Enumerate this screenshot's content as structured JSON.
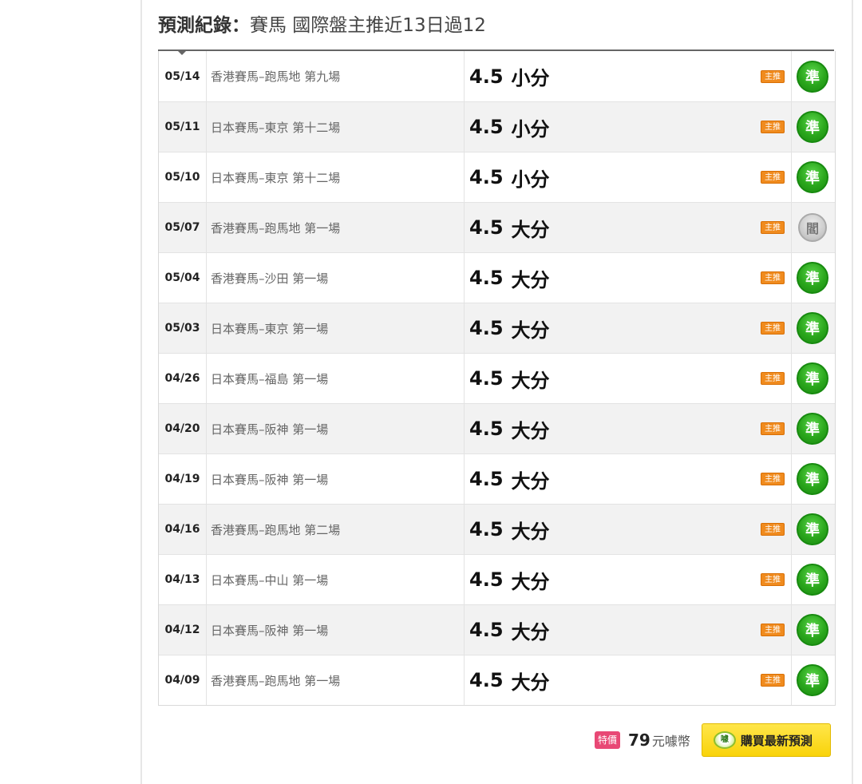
{
  "header": {
    "title_bold": "預測紀錄：",
    "title_rest": "賽馬 國際盤主推近13日過12"
  },
  "records": [
    {
      "date": "05/14",
      "event": "香港賽馬–跑馬地 第九場",
      "value": "4.5",
      "pick": "小分",
      "tag": "主推",
      "result": "準",
      "result_type": "win"
    },
    {
      "date": "05/11",
      "event": "日本賽馬–東京 第十二場",
      "value": "4.5",
      "pick": "小分",
      "tag": "主推",
      "result": "準",
      "result_type": "win"
    },
    {
      "date": "05/10",
      "event": "日本賽馬–東京 第十二場",
      "value": "4.5",
      "pick": "小分",
      "tag": "主推",
      "result": "準",
      "result_type": "win"
    },
    {
      "date": "05/07",
      "event": "香港賽馬–跑馬地 第一場",
      "value": "4.5",
      "pick": "大分",
      "tag": "主推",
      "result": "閻",
      "result_type": "void"
    },
    {
      "date": "05/04",
      "event": "香港賽馬–沙田 第一場",
      "value": "4.5",
      "pick": "大分",
      "tag": "主推",
      "result": "準",
      "result_type": "win"
    },
    {
      "date": "05/03",
      "event": "日本賽馬–東京 第一場",
      "value": "4.5",
      "pick": "大分",
      "tag": "主推",
      "result": "準",
      "result_type": "win"
    },
    {
      "date": "04/26",
      "event": "日本賽馬–福島 第一場",
      "value": "4.5",
      "pick": "大分",
      "tag": "主推",
      "result": "準",
      "result_type": "win"
    },
    {
      "date": "04/20",
      "event": "日本賽馬–阪神 第一場",
      "value": "4.5",
      "pick": "大分",
      "tag": "主推",
      "result": "準",
      "result_type": "win"
    },
    {
      "date": "04/19",
      "event": "日本賽馬–阪神 第一場",
      "value": "4.5",
      "pick": "大分",
      "tag": "主推",
      "result": "準",
      "result_type": "win"
    },
    {
      "date": "04/16",
      "event": "香港賽馬–跑馬地 第二場",
      "value": "4.5",
      "pick": "大分",
      "tag": "主推",
      "result": "準",
      "result_type": "win"
    },
    {
      "date": "04/13",
      "event": "日本賽馬–中山 第一場",
      "value": "4.5",
      "pick": "大分",
      "tag": "主推",
      "result": "準",
      "result_type": "win"
    },
    {
      "date": "04/12",
      "event": "日本賽馬–阪神 第一場",
      "value": "4.5",
      "pick": "大分",
      "tag": "主推",
      "result": "準",
      "result_type": "win"
    },
    {
      "date": "04/09",
      "event": "香港賽馬–跑馬地 第一場",
      "value": "4.5",
      "pick": "大分",
      "tag": "主推",
      "result": "準",
      "result_type": "win"
    }
  ],
  "footer": {
    "special_label": "特價",
    "price": "79",
    "currency": "元噱幣",
    "coin_icon_text": "噱",
    "buy_label": "購買最新預測"
  },
  "colors": {
    "win_badge": "#2aa61c",
    "void_badge": "#c9c9c9",
    "tag_orange": "#f08b1e",
    "special_pink": "#e84875",
    "buy_yellow": "#f9d30a"
  }
}
